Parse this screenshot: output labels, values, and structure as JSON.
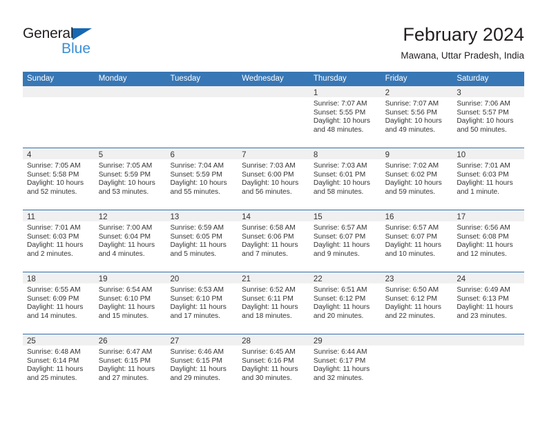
{
  "brand": {
    "name_top": "General",
    "name_bottom": "Blue",
    "triangle_color": "#1668b3",
    "blue_color": "#3c8fd4"
  },
  "header": {
    "month_title": "February 2024",
    "location": "Mawana, Uttar Pradesh, India"
  },
  "theme": {
    "header_bg": "#3877b5",
    "row_divider": "#2d6fae",
    "day_band_bg": "#f0f0f0",
    "text_color": "#333333"
  },
  "weekdays": [
    "Sunday",
    "Monday",
    "Tuesday",
    "Wednesday",
    "Thursday",
    "Friday",
    "Saturday"
  ],
  "weeks": [
    [
      {
        "empty": true
      },
      {
        "empty": true
      },
      {
        "empty": true
      },
      {
        "empty": true
      },
      {
        "date": "1",
        "sunrise": "Sunrise: 7:07 AM",
        "sunset": "Sunset: 5:55 PM",
        "daylight1": "Daylight: 10 hours",
        "daylight2": "and 48 minutes."
      },
      {
        "date": "2",
        "sunrise": "Sunrise: 7:07 AM",
        "sunset": "Sunset: 5:56 PM",
        "daylight1": "Daylight: 10 hours",
        "daylight2": "and 49 minutes."
      },
      {
        "date": "3",
        "sunrise": "Sunrise: 7:06 AM",
        "sunset": "Sunset: 5:57 PM",
        "daylight1": "Daylight: 10 hours",
        "daylight2": "and 50 minutes."
      }
    ],
    [
      {
        "date": "4",
        "sunrise": "Sunrise: 7:05 AM",
        "sunset": "Sunset: 5:58 PM",
        "daylight1": "Daylight: 10 hours",
        "daylight2": "and 52 minutes."
      },
      {
        "date": "5",
        "sunrise": "Sunrise: 7:05 AM",
        "sunset": "Sunset: 5:59 PM",
        "daylight1": "Daylight: 10 hours",
        "daylight2": "and 53 minutes."
      },
      {
        "date": "6",
        "sunrise": "Sunrise: 7:04 AM",
        "sunset": "Sunset: 5:59 PM",
        "daylight1": "Daylight: 10 hours",
        "daylight2": "and 55 minutes."
      },
      {
        "date": "7",
        "sunrise": "Sunrise: 7:03 AM",
        "sunset": "Sunset: 6:00 PM",
        "daylight1": "Daylight: 10 hours",
        "daylight2": "and 56 minutes."
      },
      {
        "date": "8",
        "sunrise": "Sunrise: 7:03 AM",
        "sunset": "Sunset: 6:01 PM",
        "daylight1": "Daylight: 10 hours",
        "daylight2": "and 58 minutes."
      },
      {
        "date": "9",
        "sunrise": "Sunrise: 7:02 AM",
        "sunset": "Sunset: 6:02 PM",
        "daylight1": "Daylight: 10 hours",
        "daylight2": "and 59 minutes."
      },
      {
        "date": "10",
        "sunrise": "Sunrise: 7:01 AM",
        "sunset": "Sunset: 6:03 PM",
        "daylight1": "Daylight: 11 hours",
        "daylight2": "and 1 minute."
      }
    ],
    [
      {
        "date": "11",
        "sunrise": "Sunrise: 7:01 AM",
        "sunset": "Sunset: 6:03 PM",
        "daylight1": "Daylight: 11 hours",
        "daylight2": "and 2 minutes."
      },
      {
        "date": "12",
        "sunrise": "Sunrise: 7:00 AM",
        "sunset": "Sunset: 6:04 PM",
        "daylight1": "Daylight: 11 hours",
        "daylight2": "and 4 minutes."
      },
      {
        "date": "13",
        "sunrise": "Sunrise: 6:59 AM",
        "sunset": "Sunset: 6:05 PM",
        "daylight1": "Daylight: 11 hours",
        "daylight2": "and 5 minutes."
      },
      {
        "date": "14",
        "sunrise": "Sunrise: 6:58 AM",
        "sunset": "Sunset: 6:06 PM",
        "daylight1": "Daylight: 11 hours",
        "daylight2": "and 7 minutes."
      },
      {
        "date": "15",
        "sunrise": "Sunrise: 6:57 AM",
        "sunset": "Sunset: 6:07 PM",
        "daylight1": "Daylight: 11 hours",
        "daylight2": "and 9 minutes."
      },
      {
        "date": "16",
        "sunrise": "Sunrise: 6:57 AM",
        "sunset": "Sunset: 6:07 PM",
        "daylight1": "Daylight: 11 hours",
        "daylight2": "and 10 minutes."
      },
      {
        "date": "17",
        "sunrise": "Sunrise: 6:56 AM",
        "sunset": "Sunset: 6:08 PM",
        "daylight1": "Daylight: 11 hours",
        "daylight2": "and 12 minutes."
      }
    ],
    [
      {
        "date": "18",
        "sunrise": "Sunrise: 6:55 AM",
        "sunset": "Sunset: 6:09 PM",
        "daylight1": "Daylight: 11 hours",
        "daylight2": "and 14 minutes."
      },
      {
        "date": "19",
        "sunrise": "Sunrise: 6:54 AM",
        "sunset": "Sunset: 6:10 PM",
        "daylight1": "Daylight: 11 hours",
        "daylight2": "and 15 minutes."
      },
      {
        "date": "20",
        "sunrise": "Sunrise: 6:53 AM",
        "sunset": "Sunset: 6:10 PM",
        "daylight1": "Daylight: 11 hours",
        "daylight2": "and 17 minutes."
      },
      {
        "date": "21",
        "sunrise": "Sunrise: 6:52 AM",
        "sunset": "Sunset: 6:11 PM",
        "daylight1": "Daylight: 11 hours",
        "daylight2": "and 18 minutes."
      },
      {
        "date": "22",
        "sunrise": "Sunrise: 6:51 AM",
        "sunset": "Sunset: 6:12 PM",
        "daylight1": "Daylight: 11 hours",
        "daylight2": "and 20 minutes."
      },
      {
        "date": "23",
        "sunrise": "Sunrise: 6:50 AM",
        "sunset": "Sunset: 6:12 PM",
        "daylight1": "Daylight: 11 hours",
        "daylight2": "and 22 minutes."
      },
      {
        "date": "24",
        "sunrise": "Sunrise: 6:49 AM",
        "sunset": "Sunset: 6:13 PM",
        "daylight1": "Daylight: 11 hours",
        "daylight2": "and 23 minutes."
      }
    ],
    [
      {
        "date": "25",
        "sunrise": "Sunrise: 6:48 AM",
        "sunset": "Sunset: 6:14 PM",
        "daylight1": "Daylight: 11 hours",
        "daylight2": "and 25 minutes."
      },
      {
        "date": "26",
        "sunrise": "Sunrise: 6:47 AM",
        "sunset": "Sunset: 6:15 PM",
        "daylight1": "Daylight: 11 hours",
        "daylight2": "and 27 minutes."
      },
      {
        "date": "27",
        "sunrise": "Sunrise: 6:46 AM",
        "sunset": "Sunset: 6:15 PM",
        "daylight1": "Daylight: 11 hours",
        "daylight2": "and 29 minutes."
      },
      {
        "date": "28",
        "sunrise": "Sunrise: 6:45 AM",
        "sunset": "Sunset: 6:16 PM",
        "daylight1": "Daylight: 11 hours",
        "daylight2": "and 30 minutes."
      },
      {
        "date": "29",
        "sunrise": "Sunrise: 6:44 AM",
        "sunset": "Sunset: 6:17 PM",
        "daylight1": "Daylight: 11 hours",
        "daylight2": "and 32 minutes."
      },
      {
        "empty": true
      },
      {
        "empty": true
      }
    ]
  ]
}
